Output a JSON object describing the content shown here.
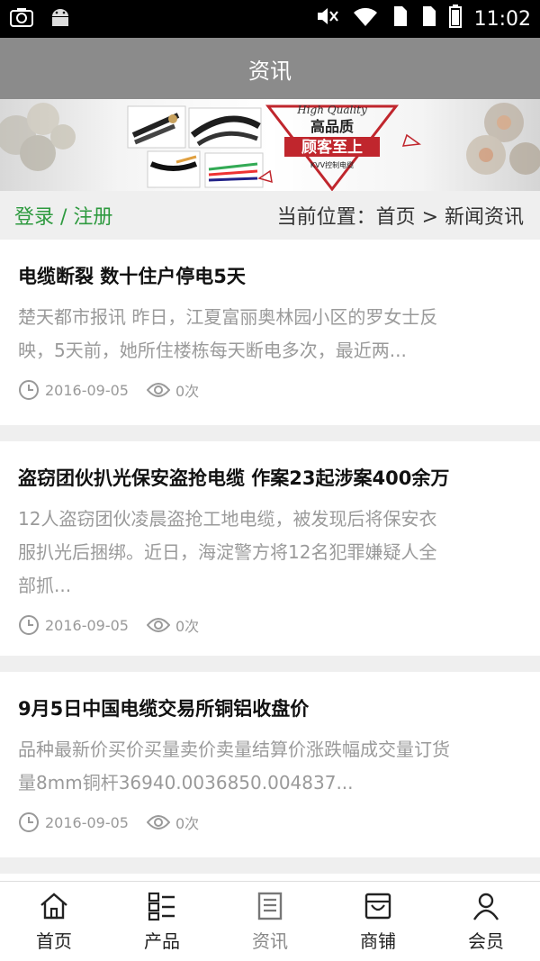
{
  "status_bar": {
    "time": "11:02"
  },
  "header": {
    "title": "资讯"
  },
  "banner": {
    "quality_en": "High Quality",
    "quality_cn": "高品质",
    "slogan": "顾客至上",
    "brand": "KVV控制电缆"
  },
  "breadcrumb": {
    "login_label": "登录 / 注册",
    "location_label": "当前位置：首页 > 新闻资讯"
  },
  "articles": [
    {
      "title": "电缆断裂 数十住户停电5天",
      "summary_line1": "楚天都市报讯 昨日，江夏富丽奥林园小区的罗女士反",
      "summary_line2": "映，5天前，她所住楼栋每天断电多次，最近两...",
      "summary_line3": "",
      "date": "2016-09-05",
      "views": "0次"
    },
    {
      "title": "盗窃团伙扒光保安盗抢电缆 作案23起涉案400余万",
      "summary_line1": "12人盗窃团伙凌晨盗抢工地电缆，被发现后将保安衣",
      "summary_line2": "服扒光后捆绑。近日，海淀警方将12名犯罪嫌疑人全",
      "summary_line3": "部抓...",
      "date": "2016-09-05",
      "views": "0次"
    },
    {
      "title": "9月5日中国电缆交易所铜铝收盘价",
      "summary_line1": "品种最新价买价买量卖价卖量结算价涨跌幅成交量订货",
      "summary_line2": "量8mm铜杆36940.0036850.004837...",
      "summary_line3": "",
      "date": "2016-09-05",
      "views": "0次"
    }
  ],
  "bottom_nav": [
    {
      "label": "首页",
      "icon": "home-icon"
    },
    {
      "label": "产品",
      "icon": "list-icon"
    },
    {
      "label": "资讯",
      "icon": "news-icon"
    },
    {
      "label": "商铺",
      "icon": "shop-icon"
    },
    {
      "label": "会员",
      "icon": "user-icon"
    }
  ],
  "colors": {
    "accent_green": "#2e9a3f",
    "title_bar": "#8b8b8b",
    "banner_red": "#c0262d"
  }
}
